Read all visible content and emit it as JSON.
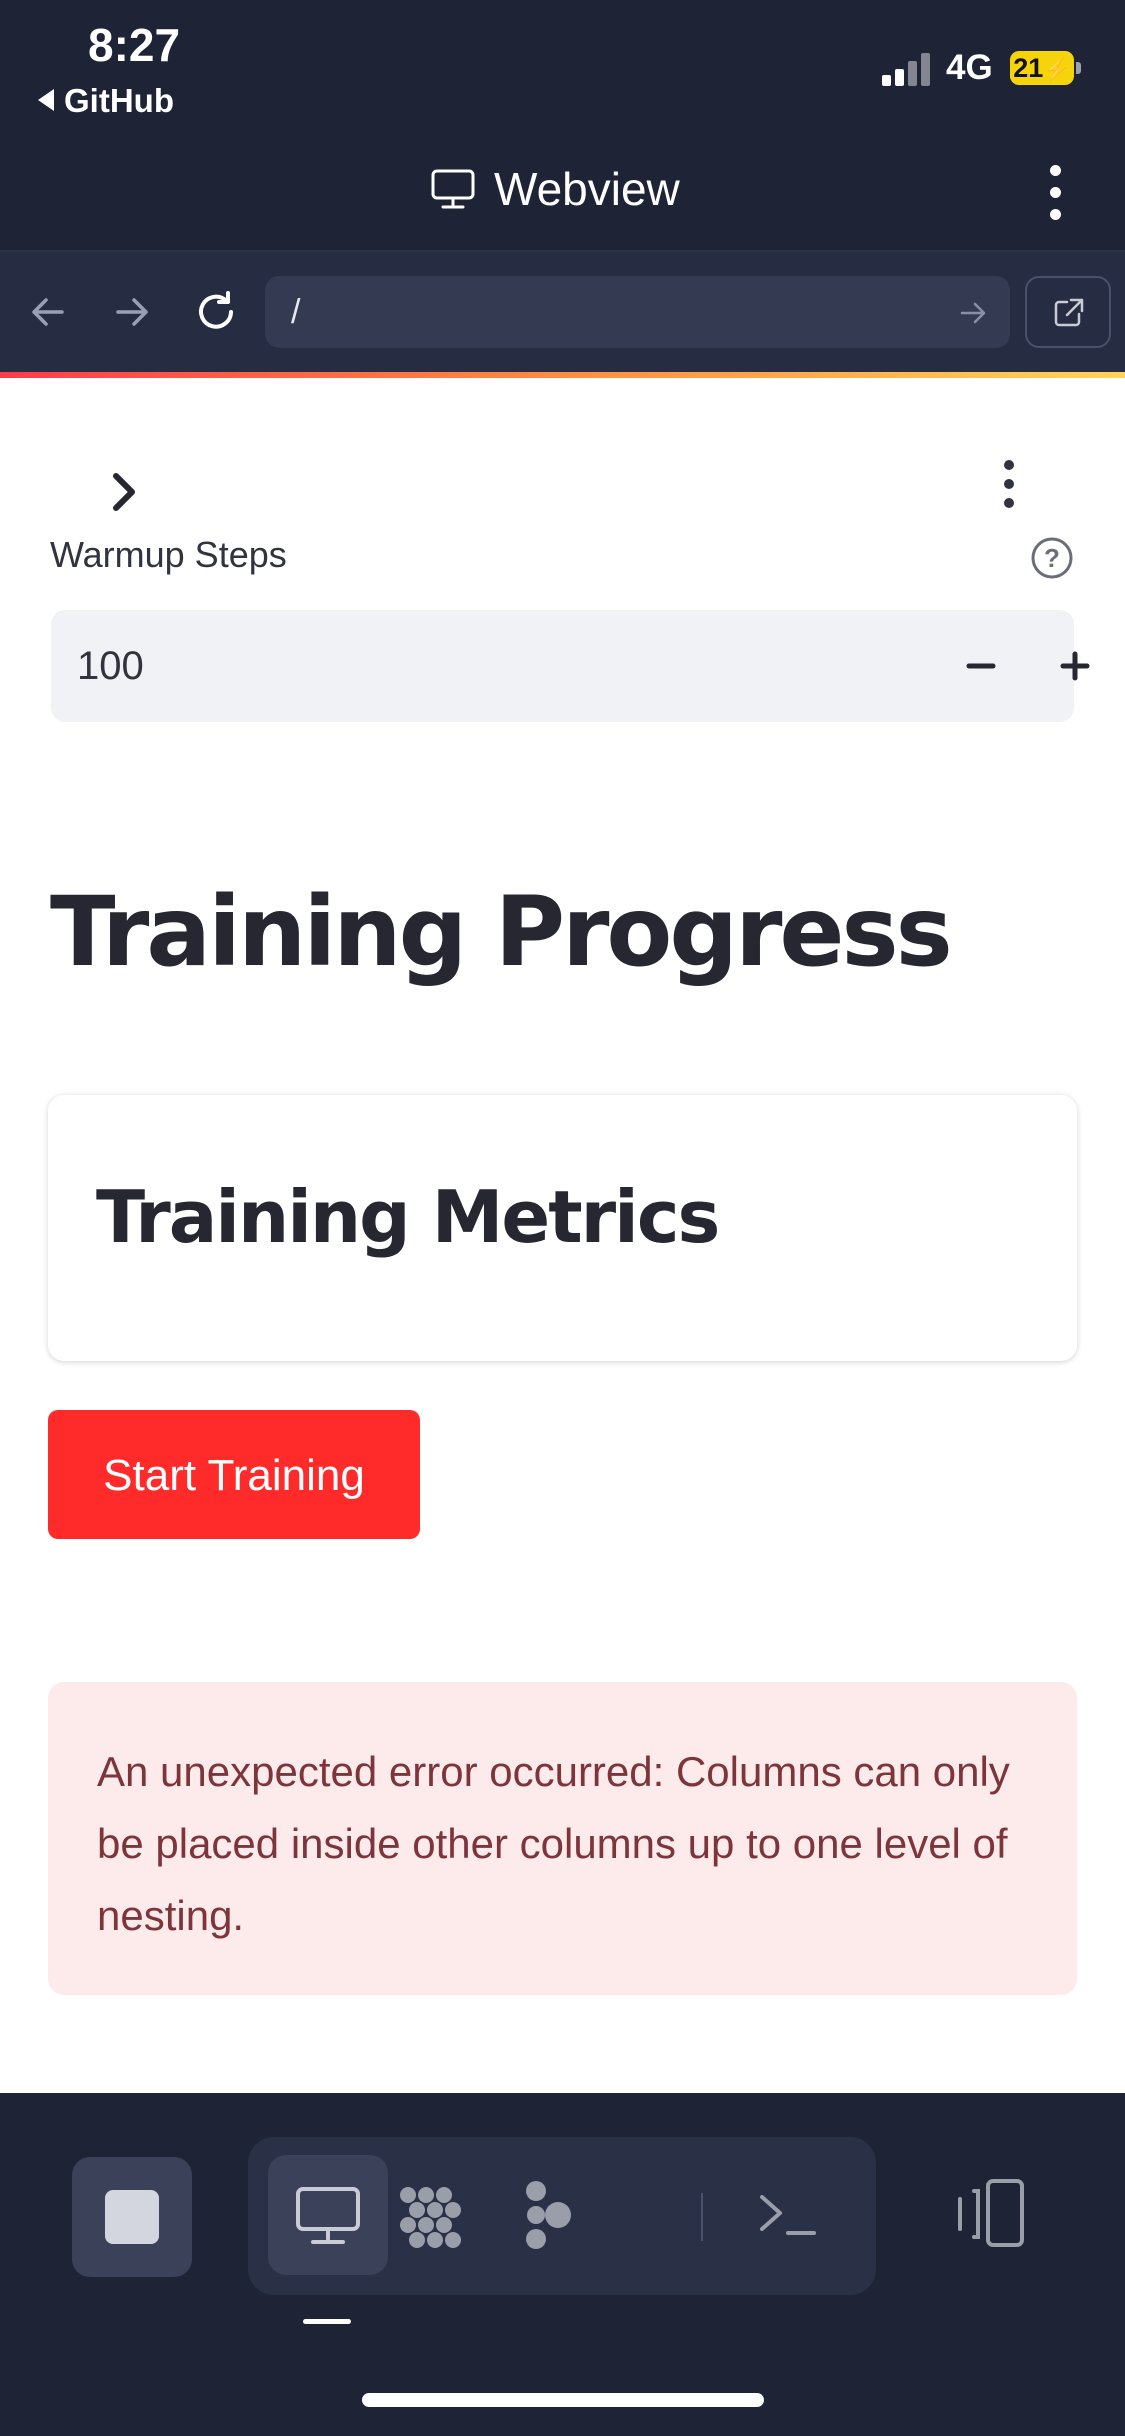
{
  "status_bar": {
    "time": "8:27",
    "back_app": "GitHub",
    "network": "4G",
    "battery": "21"
  },
  "title_bar": {
    "icon": "monitor-icon",
    "title": "Webview",
    "menu_icon": "more-vertical-icon"
  },
  "url_bar": {
    "back_icon": "arrow-left-icon",
    "forward_icon": "arrow-right-icon",
    "reload_icon": "reload-icon",
    "url": "/",
    "go_icon": "arrow-right-icon",
    "open_external_icon": "external-link-icon"
  },
  "app": {
    "sidebar_toggle_icon": "chevron-right-icon",
    "menu_icon": "more-vertical-icon",
    "warmup": {
      "label": "Warmup Steps",
      "value": "100",
      "help_icon": "question-circle-icon",
      "decrement_label": "−",
      "increment_label": "+"
    },
    "heading": "Training Progress",
    "metrics_card": {
      "heading": "Training Metrics"
    },
    "start_button": "Start Training",
    "error": {
      "message": "An unexpected error occurred: Columns can only be placed inside other columns up to one level of nesting."
    }
  },
  "toolbar": {
    "stop_icon": "stop-icon",
    "tabs": [
      {
        "name": "webview",
        "icon": "monitor-icon",
        "active": true
      },
      {
        "name": "components",
        "icon": "dots-grid-icon",
        "active": false
      },
      {
        "name": "graph",
        "icon": "node-graph-icon",
        "active": false
      },
      {
        "name": "terminal",
        "icon": "terminal-icon",
        "active": false
      }
    ],
    "device_icon": "device-toggle-icon"
  },
  "colors": {
    "chrome_bg": "#1e2336",
    "primary_button": "#ff2b2b",
    "error_bg": "#fdebeb",
    "error_text": "#7d353b",
    "battery": "#f5d40c"
  }
}
